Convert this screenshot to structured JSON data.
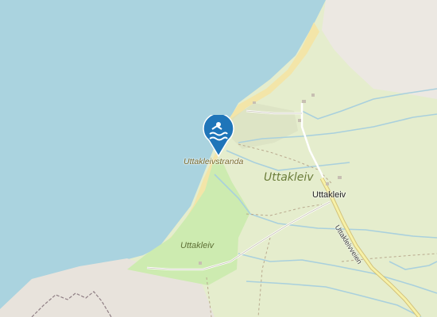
{
  "map": {
    "colors": {
      "water": "#aad3df",
      "grass": "#e5edcd",
      "meadow": "#cdebb0",
      "sand": "#f3e5a8",
      "rock": "#e8e3dc",
      "stream": "#a9d0dd",
      "pin": "#1f75b9"
    },
    "labels": {
      "beach": "Uttakleivstranda",
      "area": "Uttakleiv",
      "meadow_area": "Uttakleiv",
      "hamlet": "Uttakleiv",
      "road": "Uttakleivveien"
    },
    "markers": [
      {
        "icon": "swimming-icon",
        "label": "Uttakleivstranda"
      }
    ]
  }
}
